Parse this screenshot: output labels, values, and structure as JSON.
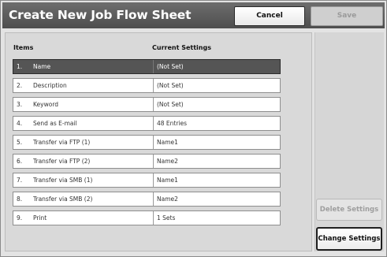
{
  "header": {
    "title": "Create New Job Flow Sheet",
    "cancel_label": "Cancel",
    "save_label": "Save"
  },
  "table": {
    "col_items": "Items",
    "col_current": "Current Settings",
    "rows": [
      {
        "num": "1.",
        "name": "Name",
        "value": "(Not Set)",
        "selected": true
      },
      {
        "num": "2.",
        "name": "Description",
        "value": "(Not Set)"
      },
      {
        "num": "3.",
        "name": "Keyword",
        "value": "(Not Set)"
      },
      {
        "num": "4.",
        "name": "Send as E-mail",
        "value": "48 Entries"
      },
      {
        "num": "5.",
        "name": "Transfer via FTP (1)",
        "value": "Name1"
      },
      {
        "num": "6.",
        "name": "Transfer via FTP (2)",
        "value": "Name2"
      },
      {
        "num": "7.",
        "name": "Transfer via SMB (1)",
        "value": "Name1"
      },
      {
        "num": "8.",
        "name": "Transfer via SMB (2)",
        "value": "Name2"
      },
      {
        "num": "9.",
        "name": "Print",
        "value": "1 Sets"
      }
    ]
  },
  "side": {
    "delete_label": "Delete Settings",
    "change_label": "Change Settings"
  }
}
